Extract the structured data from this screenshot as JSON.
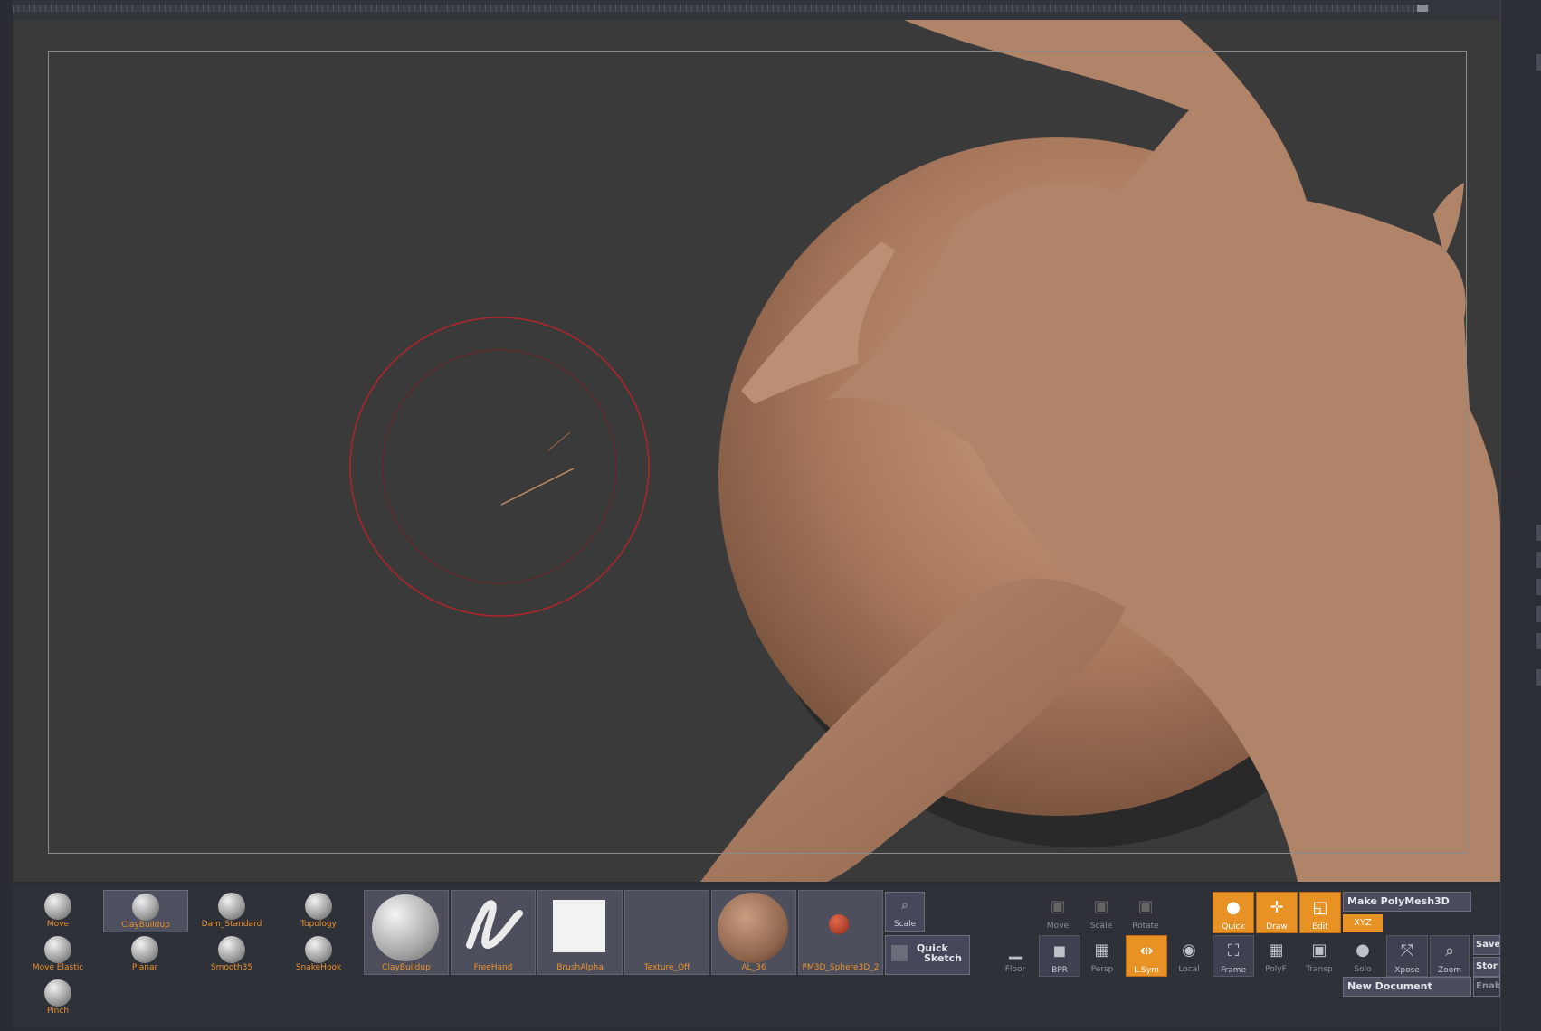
{
  "brushes": [
    {
      "label": "Move",
      "selected": false
    },
    {
      "label": "ClayBuildup",
      "selected": true
    },
    {
      "label": "Dam_Standard",
      "selected": false
    },
    {
      "label": "Topology",
      "selected": false
    },
    {
      "label": "Move Elastic",
      "selected": false
    },
    {
      "label": "Planar",
      "selected": false
    },
    {
      "label": "Smooth35",
      "selected": false
    },
    {
      "label": "SnakeHook",
      "selected": false
    },
    {
      "label": "Pinch",
      "selected": false
    }
  ],
  "tiles": {
    "brush": "ClayBuildup",
    "stroke": "FreeHand",
    "alpha": "BrushAlpha",
    "texture": "Texture_Off",
    "material": "AL_36",
    "tool": "PM3D_Sphere3D_2"
  },
  "scale_button": "Scale",
  "quick_sketch": {
    "line1": "Quick",
    "line2": "Sketch"
  },
  "transform": {
    "move": "Move",
    "scale": "Scale",
    "rotate": "Rotate"
  },
  "modes": {
    "quick": "Quick",
    "draw": "Draw",
    "edit": "Edit"
  },
  "view_buttons": {
    "floor": "Floor",
    "bpr": "BPR",
    "persp": "Persp",
    "lsym": "L.Sym",
    "local": "Local",
    "frame": "Frame",
    "polyf": "PolyF",
    "transp": "Transp",
    "solo": "Solo",
    "xpose": "Xpose",
    "zoom": "Zoom"
  },
  "xyz": "XYZ",
  "make_polymesh": "Make PolyMesh3D",
  "new_document": "New Document",
  "save": "Save",
  "store": "Stor",
  "enable": "Enab",
  "colors": {
    "accent": "#e89225",
    "model": "#b08468",
    "brush_ring": "#b3242a"
  }
}
